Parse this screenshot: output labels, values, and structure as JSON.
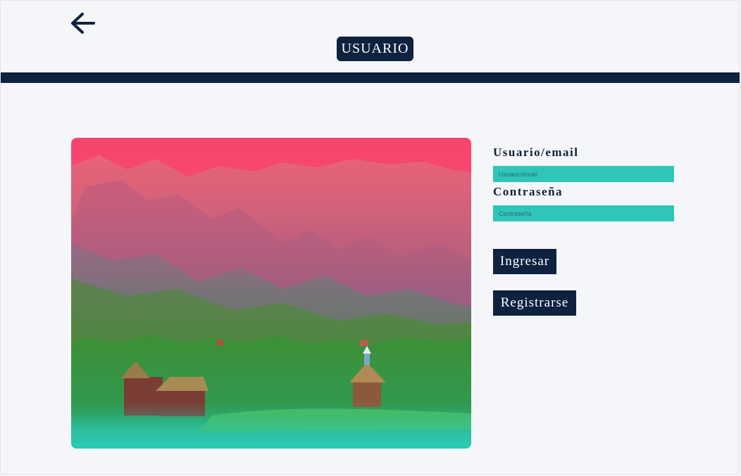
{
  "header": {
    "back_icon": "arrow-left-icon",
    "title": "USUARIO"
  },
  "hero": {
    "description_colors": {
      "top": "#f7456d",
      "bottom": "#2bc9b4"
    }
  },
  "form": {
    "username": {
      "label": "Usuario/email",
      "placeholder": "Usuario/email",
      "value": ""
    },
    "password": {
      "label": "Contraseña",
      "placeholder": "Contraseña",
      "value": ""
    },
    "login_button": "Ingresar",
    "register_button": "Registrarse"
  },
  "colors": {
    "navy": "#0e2240",
    "teal": "#2fc5ba",
    "background": "#f5f6f9"
  }
}
